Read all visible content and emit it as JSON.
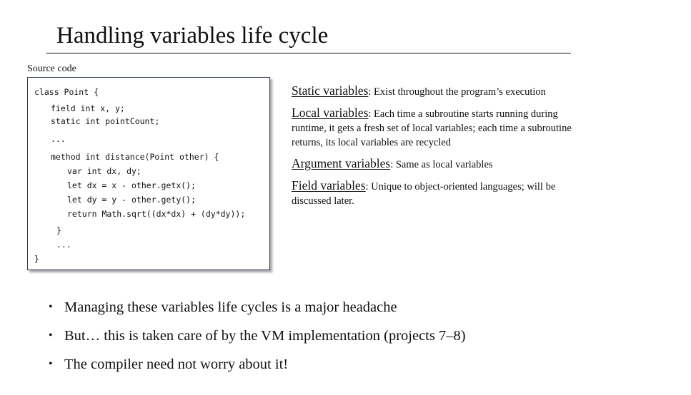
{
  "slide": {
    "title": "Handling variables life cycle"
  },
  "source": {
    "caption": "Source code",
    "lines": [
      "class Point {",
      "field int x, y;",
      "static int pointCount;",
      "...",
      "method int distance(Point other) {",
      "var int dx, dy;",
      "let dx = x - other.getx();",
      "let dy = y - other.gety();",
      "return Math.sqrt((dx*dx) + (dy*dy));",
      "}",
      "...",
      "}"
    ]
  },
  "definitions": [
    {
      "term": "Static variables",
      "text": ": Exist throughout the program’s execution"
    },
    {
      "term": "Local variables",
      "text": ": Each time a subroutine starts running during runtime, it gets a fresh set of local variables; each time a subroutine returns, its local variables are recycled"
    },
    {
      "term": "Argument variables",
      "text": ": Same as local variables"
    },
    {
      "term": "Field variables",
      "text": ": Unique to object-oriented languages; will be discussed later."
    }
  ],
  "bullets": {
    "marker": "•",
    "items": [
      "Managing these variables life cycles is a major headache",
      "But… this is taken care of by the VM implementation (projects 7–8)",
      "The compiler need not worry about it!"
    ]
  }
}
